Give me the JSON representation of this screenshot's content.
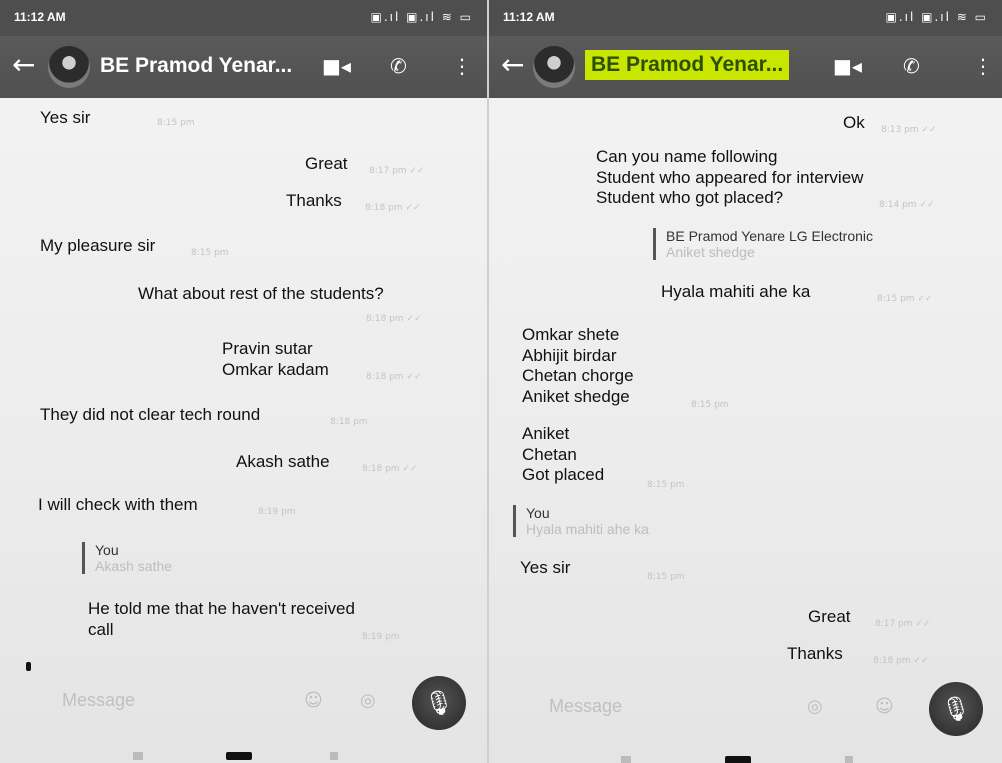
{
  "left": {
    "status_time": "11:12 AM",
    "status_icons": "▣.ıl ▣.ıl ≋ ▭",
    "title": "BE Pramod Yenar...",
    "messages": [
      {
        "text": "Yes sir",
        "time": "8:15 pm"
      },
      {
        "text": "Great",
        "time": "8:17 pm ✓✓"
      },
      {
        "text": "Thanks",
        "time": "8:18 pm ✓✓"
      },
      {
        "text": "My pleasure sir",
        "time": "8:15 pm"
      },
      {
        "text": "What about rest of the students?",
        "time": "8:18 pm ✓✓"
      },
      {
        "text": "Pravin sutar\nOmkar kadam",
        "time": "8:18 pm ✓✓"
      },
      {
        "text": "They did not clear tech round",
        "time": "8:18 pm"
      },
      {
        "text": "Akash sathe",
        "time": "8:18 pm ✓✓"
      },
      {
        "text": "I will check with them",
        "time": "8:19 pm"
      },
      {
        "text": "He told me that he haven't received\ncall",
        "time": "8:19 pm"
      }
    ],
    "quote": {
      "author": "You",
      "text": "Akash sathe"
    },
    "placeholder": "Message"
  },
  "right": {
    "status_time": "11:12 AM",
    "status_icons": "▣.ıl ▣.ıl ≋ ▭",
    "title": "BE Pramod Yenar...",
    "messages": [
      {
        "text": "Ok",
        "time": "8:13 pm ✓✓"
      },
      {
        "text": "Can you name following\nStudent who appeared for interview\nStudent who got placed?",
        "time": "8:14 pm ✓✓"
      },
      {
        "text": "Hyala mahiti ahe ka",
        "time": "8:15 pm ✓✓"
      },
      {
        "text": "Omkar shete\nAbhijit birdar\nChetan chorge\nAniket shedge",
        "time": "8:15 pm"
      },
      {
        "text": "Aniket\nChetan\nGot placed",
        "time": "8:15 pm"
      },
      {
        "text": "Yes sir",
        "time": "8:15 pm"
      },
      {
        "text": "Great",
        "time": "8:17 pm ✓✓"
      },
      {
        "text": "Thanks",
        "time": "8:18 pm ✓✓"
      }
    ],
    "quote1": {
      "author": "BE Pramod Yenare LG Electronic",
      "text": "Aniket shedge"
    },
    "quote2": {
      "author": "You",
      "text": "Hyala mahiti ahe ka"
    },
    "placeholder": "Message"
  },
  "icons": {
    "back": "back-arrow-icon",
    "video": "video-call-icon",
    "call": "phone-call-icon",
    "menu": "more-options-icon",
    "mic": "microphone-icon",
    "emoji": "emoji-icon",
    "camera": "camera-icon"
  }
}
